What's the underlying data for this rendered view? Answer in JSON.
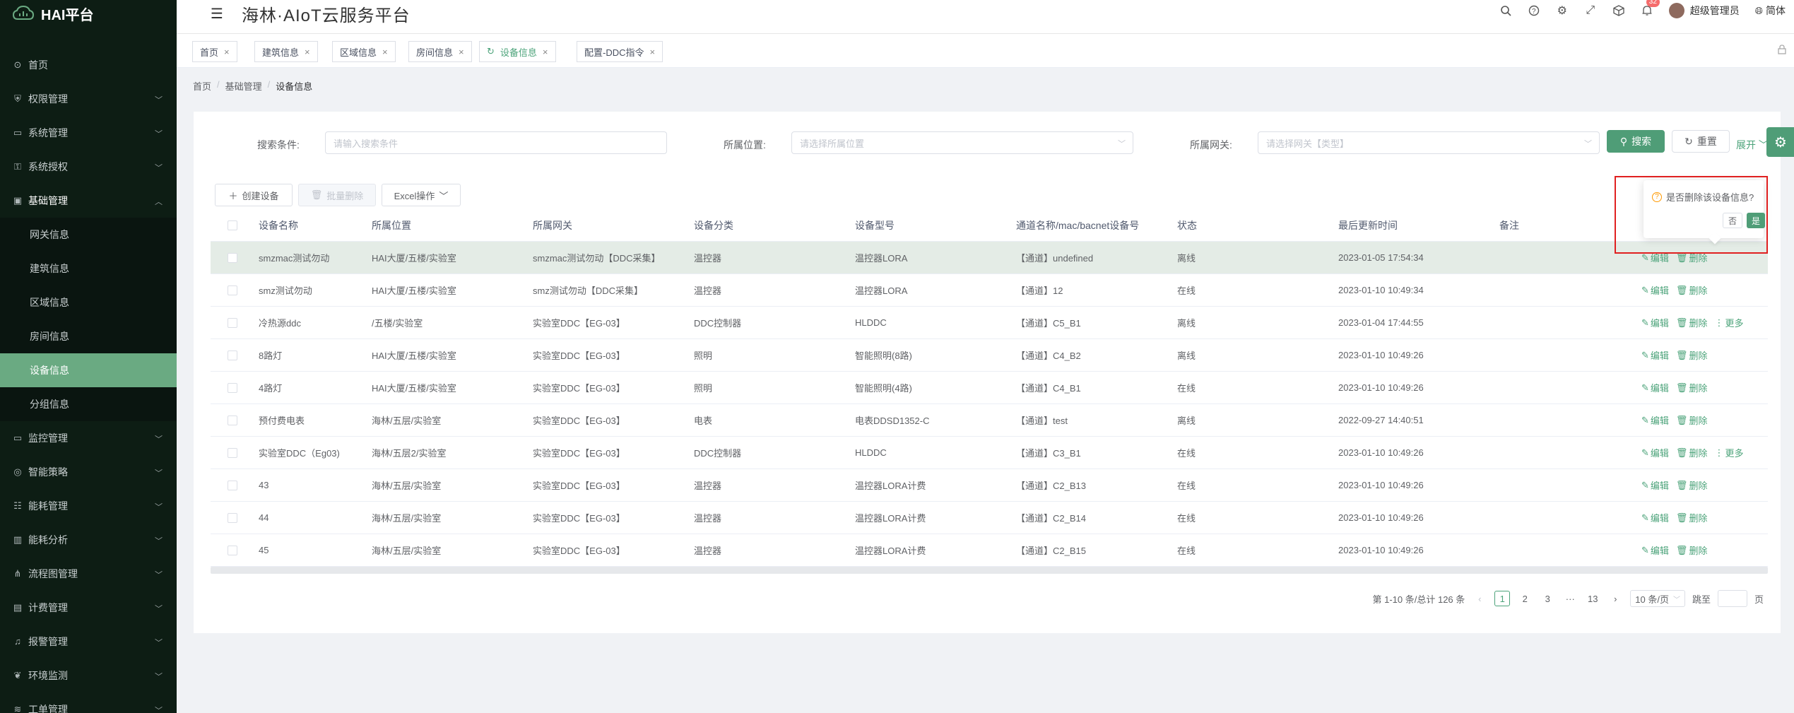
{
  "brand": {
    "name": "HAI平台"
  },
  "header": {
    "title": "海林·AIoT云服务平台",
    "notification_count": "32",
    "user_name": "超级管理员",
    "language": "简体"
  },
  "sidebar": {
    "items": [
      {
        "label": "首页",
        "icon": "home-icon",
        "has_children": false
      },
      {
        "label": "权限管理",
        "icon": "shield-icon",
        "has_children": true
      },
      {
        "label": "系统管理",
        "icon": "monitor-icon",
        "has_children": true
      },
      {
        "label": "系统授权",
        "icon": "key-icon",
        "has_children": true
      },
      {
        "label": "基础管理",
        "icon": "folder-icon",
        "has_children": true,
        "open": true
      }
    ],
    "sub_items": [
      {
        "label": "网关信息"
      },
      {
        "label": "建筑信息"
      },
      {
        "label": "区域信息"
      },
      {
        "label": "房间信息"
      },
      {
        "label": "设备信息",
        "active": true
      },
      {
        "label": "分组信息"
      }
    ],
    "items_after": [
      {
        "label": "监控管理",
        "icon": "monitor-icon"
      },
      {
        "label": "智能策略",
        "icon": "bulb-icon"
      },
      {
        "label": "能耗管理",
        "icon": "sliders-icon"
      },
      {
        "label": "能耗分析",
        "icon": "chart-icon"
      },
      {
        "label": "流程图管理",
        "icon": "flow-icon"
      },
      {
        "label": "计费管理",
        "icon": "wallet-icon"
      },
      {
        "label": "报警管理",
        "icon": "bell-icon"
      },
      {
        "label": "环境监测",
        "icon": "leaf-icon"
      },
      {
        "label": "工单管理",
        "icon": "layers-icon"
      }
    ]
  },
  "tabs": [
    {
      "label": "首页"
    },
    {
      "label": "建筑信息"
    },
    {
      "label": "区域信息"
    },
    {
      "label": "房间信息"
    },
    {
      "label": "设备信息",
      "active": true
    },
    {
      "label": "配置-DDC指令"
    }
  ],
  "breadcrumb": [
    "首页",
    "基础管理",
    "设备信息"
  ],
  "search": {
    "cond_label": "搜索条件:",
    "cond_placeholder": "请输入搜索条件",
    "location_label": "所属位置:",
    "location_placeholder": "请选择所属位置",
    "gateway_label": "所属网关:",
    "gateway_placeholder": "请选择网关【类型】",
    "search_btn": "搜索",
    "reset_btn": "重置",
    "expand": "展开"
  },
  "toolbar": {
    "create": "创建设备",
    "batch_delete": "批量删除",
    "excel": "Excel操作"
  },
  "table": {
    "columns": [
      "设备名称",
      "所属位置",
      "所属网关",
      "设备分类",
      "设备型号",
      "通道名称/mac/bacnet设备号",
      "状态",
      "最后更新时间",
      "备注"
    ],
    "rows": [
      {
        "name": "smzmac测试勿动",
        "location": "HAI大厦/五楼/实验室",
        "gateway": "smzmac测试勿动【DDC采集】",
        "category": "温控器",
        "model": "温控器LORA",
        "channel": "【通道】undefined",
        "status": "离线",
        "updated": "2023-01-05 17:54:34",
        "remark": "",
        "edit": "编辑",
        "delete": "删除",
        "more": "",
        "highlight": true
      },
      {
        "name": "smz测试勿动",
        "location": "HAI大厦/五楼/实验室",
        "gateway": "smz测试勿动【DDC采集】",
        "category": "温控器",
        "model": "温控器LORA",
        "channel": "【通道】12",
        "status": "在线",
        "updated": "2023-01-10 10:49:34",
        "remark": "",
        "edit": "编辑",
        "delete": "删除",
        "more": ""
      },
      {
        "name": "冷热源ddc",
        "location": "/五楼/实验室",
        "gateway": "实验室DDC【EG-03】",
        "category": "DDC控制器",
        "model": "HLDDC",
        "channel": "【通道】C5_B1",
        "status": "离线",
        "updated": "2023-01-04 17:44:55",
        "remark": "",
        "edit": "编辑",
        "delete": "删除",
        "more": "更多"
      },
      {
        "name": "8路灯",
        "location": "HAI大厦/五楼/实验室",
        "gateway": "实验室DDC【EG-03】",
        "category": "照明",
        "model": "智能照明(8路)",
        "channel": "【通道】C4_B2",
        "status": "离线",
        "updated": "2023-01-10 10:49:26",
        "remark": "",
        "edit": "编辑",
        "delete": "删除",
        "more": ""
      },
      {
        "name": "4路灯",
        "location": "HAI大厦/五楼/实验室",
        "gateway": "实验室DDC【EG-03】",
        "category": "照明",
        "model": "智能照明(4路)",
        "channel": "【通道】C4_B1",
        "status": "在线",
        "updated": "2023-01-10 10:49:26",
        "remark": "",
        "edit": "编辑",
        "delete": "删除",
        "more": ""
      },
      {
        "name": "预付费电表",
        "location": "海林/五层/实验室",
        "gateway": "实验室DDC【EG-03】",
        "category": "电表",
        "model": "电表DDSD1352-C",
        "channel": "【通道】test",
        "status": "离线",
        "updated": "2022-09-27 14:40:51",
        "remark": "",
        "edit": "编辑",
        "delete": "删除",
        "more": ""
      },
      {
        "name": "实验室DDC（Eg03)",
        "location": "海林/五层2/实验室",
        "gateway": "实验室DDC【EG-03】",
        "category": "DDC控制器",
        "model": "HLDDC",
        "channel": "【通道】C3_B1",
        "status": "在线",
        "updated": "2023-01-10 10:49:26",
        "remark": "",
        "edit": "编辑",
        "delete": "删除",
        "more": "更多"
      },
      {
        "name": "43",
        "location": "海林/五层/实验室",
        "gateway": "实验室DDC【EG-03】",
        "category": "温控器",
        "model": "温控器LORA计费",
        "channel": "【通道】C2_B13",
        "status": "在线",
        "updated": "2023-01-10 10:49:26",
        "remark": "",
        "edit": "编辑",
        "delete": "删除",
        "more": ""
      },
      {
        "name": "44",
        "location": "海林/五层/实验室",
        "gateway": "实验室DDC【EG-03】",
        "category": "温控器",
        "model": "温控器LORA计费",
        "channel": "【通道】C2_B14",
        "status": "在线",
        "updated": "2023-01-10 10:49:26",
        "remark": "",
        "edit": "编辑",
        "delete": "删除",
        "more": ""
      },
      {
        "name": "45",
        "location": "海林/五层/实验室",
        "gateway": "实验室DDC【EG-03】",
        "category": "温控器",
        "model": "温控器LORA计费",
        "channel": "【通道】C2_B15",
        "status": "在线",
        "updated": "2023-01-10 10:49:26",
        "remark": "",
        "edit": "编辑",
        "delete": "删除",
        "more": ""
      }
    ]
  },
  "pagination": {
    "summary": "第 1-10 条/总计 126 条",
    "pages": [
      "1",
      "2",
      "3",
      "···",
      "13"
    ],
    "page_size": "10 条/页",
    "jump_label": "跳至",
    "page_suffix": "页"
  },
  "popconfirm": {
    "message": "是否删除该设备信息?",
    "no": "否",
    "yes": "是"
  },
  "colors": {
    "accent": "#4f9d77",
    "sidebar_bg": "#0d1d14",
    "sidebar_active": "#6aaa82",
    "highlight_box": "#e02020"
  }
}
